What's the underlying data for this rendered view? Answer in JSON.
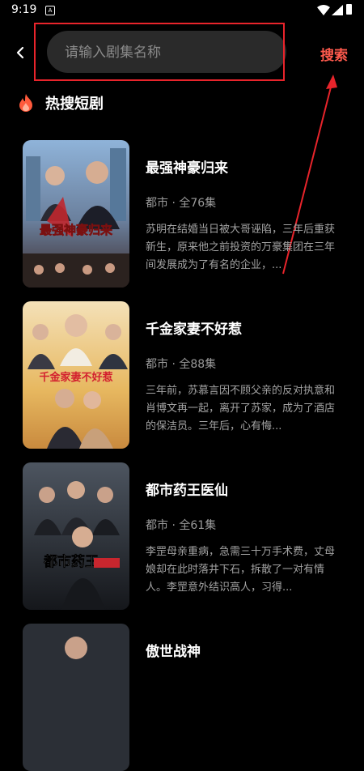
{
  "status_bar": {
    "time": "9:19",
    "notification_glyph": "A"
  },
  "header": {
    "search_placeholder": "请输入剧集名称",
    "search_label": "搜索",
    "highlight_color": "#e8242b",
    "accent_color": "#ff5a4d"
  },
  "section": {
    "title": "热搜短剧",
    "icon": "fire-icon"
  },
  "dramas": [
    {
      "title": "最强神豪归来",
      "meta": "都市 · 全76集",
      "description": "苏明在结婚当日被大哥诬陷，三年后重获新生，原来他之前投资的万豪集团在三年间发展成为了有名的企业，...",
      "poster_caption": "最强神豪归来"
    },
    {
      "title": "千金家妻不好惹",
      "meta": "都市 · 全88集",
      "description": "三年前，苏慕言因不顾父亲的反对执意和肖博文再一起，离开了苏家，成为了酒店的保洁员。三年后，心有悔...",
      "poster_caption": "千金家妻不好惹"
    },
    {
      "title": "都市药王医仙",
      "meta": "都市 · 全61集",
      "description": "李罡母亲重病，急需三十万手术费，丈母娘却在此时落井下石，拆散了一对有情人。李罡意外结识高人，习得...",
      "poster_caption": "都市药王"
    },
    {
      "title": "傲世战神",
      "meta": "",
      "description": "",
      "poster_caption": ""
    }
  ]
}
